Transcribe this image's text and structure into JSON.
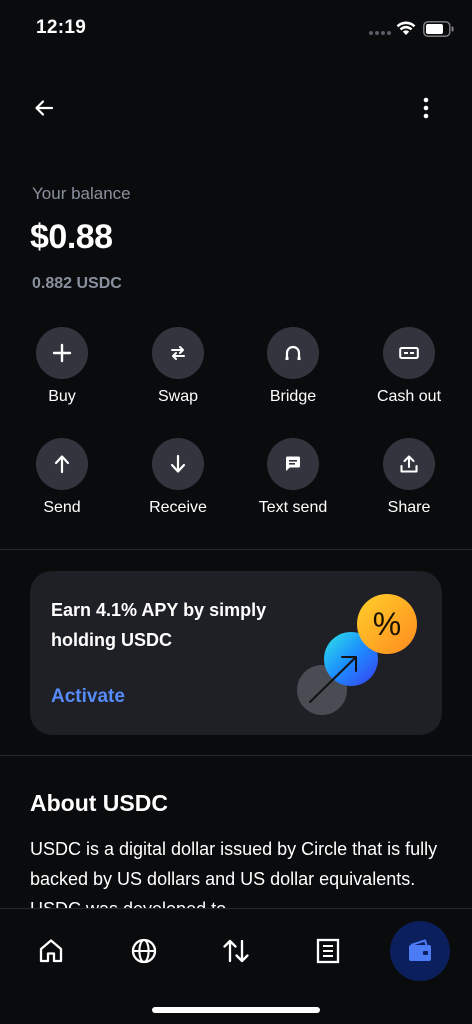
{
  "status_bar": {
    "time": "12:19"
  },
  "balance": {
    "label": "Your balance",
    "amount": "$0.88",
    "token_amount": "0.882 USDC"
  },
  "actions": [
    {
      "label": "Buy",
      "icon": "plus-icon"
    },
    {
      "label": "Swap",
      "icon": "swap-icon"
    },
    {
      "label": "Bridge",
      "icon": "bridge-icon"
    },
    {
      "label": "Cash out",
      "icon": "cash-icon"
    },
    {
      "label": "Send",
      "icon": "arrow-up-icon"
    },
    {
      "label": "Receive",
      "icon": "arrow-down-icon"
    },
    {
      "label": "Text send",
      "icon": "message-icon"
    },
    {
      "label": "Share",
      "icon": "share-icon"
    }
  ],
  "earn_card": {
    "title": "Earn 4.1% APY by simply holding USDC",
    "cta": "Activate",
    "illustration_glyph": "%"
  },
  "about": {
    "title": "About USDC",
    "body": "USDC is a digital dollar issued by Circle that is fully backed by US dollars and US dollar equivalents. USDC was developed to"
  },
  "tabs": [
    {
      "name": "home",
      "icon": "home-icon",
      "active": false
    },
    {
      "name": "explore",
      "icon": "globe-icon",
      "active": false
    },
    {
      "name": "trade",
      "icon": "transfer-icon",
      "active": false
    },
    {
      "name": "activity",
      "icon": "document-icon",
      "active": false
    },
    {
      "name": "wallet",
      "icon": "wallet-icon",
      "active": true
    }
  ],
  "colors": {
    "background": "#0a0b0d",
    "accent": "#578bfa",
    "muted": "#8a919e",
    "action_circle": "#32353d",
    "card": "#1e2025"
  }
}
